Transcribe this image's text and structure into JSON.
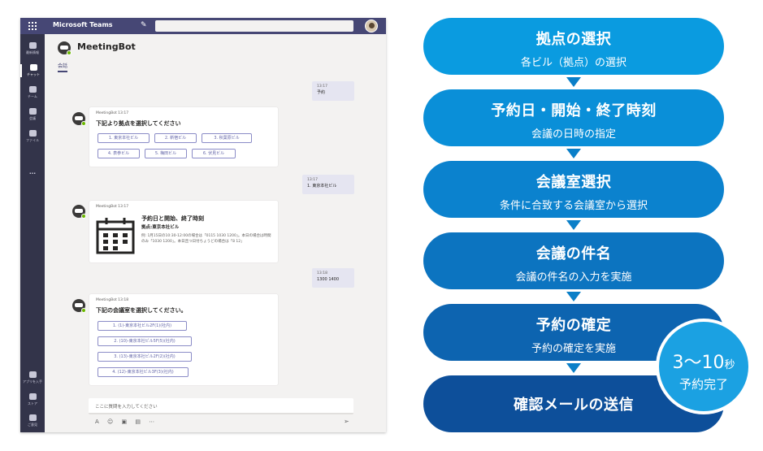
{
  "teams": {
    "app_name": "Microsoft Teams",
    "rail": [
      {
        "label": "最新情報"
      },
      {
        "label": "チャット"
      },
      {
        "label": "チーム"
      },
      {
        "label": "会議"
      },
      {
        "label": "ファイル"
      }
    ],
    "rail_more": "…",
    "rail_bottom": [
      {
        "label": "アプリを入手"
      },
      {
        "label": "ストア"
      },
      {
        "label": "ご意見"
      }
    ],
    "chat_title": "MeetingBot",
    "chat_tab": "会話",
    "messages": {
      "user1": {
        "time": "13:17",
        "text": "予約"
      },
      "bot1": {
        "meta": "MeetingBot  13:17",
        "heading": "下記より拠点を選択してください",
        "choices": [
          "1. 東京本社ビル",
          "2. 新宿ビル",
          "3. 秋葉原ビル",
          "4. 表参ビル",
          "5. 梅田ビル",
          "6. 伏見ビル"
        ]
      },
      "user2": {
        "time": "13:17",
        "text": "1. 東京本社ビル"
      },
      "bot2": {
        "meta": "MeetingBot  13:17",
        "heading": "予約日と開始、終了時刻",
        "subheading": "拠点:東京本社ビル",
        "body": "例: 1月15日の10:30-12:00の場合は「0115 1030 1200」。本日の場合は時間のみ「1030 1200」。本日且つ日付ちょうどの場合は「8 12」"
      },
      "user3": {
        "time": "13:18",
        "text": "1300 1400"
      },
      "bot3": {
        "meta": "MeetingBot  13:18",
        "heading": "下記の会議室を選択してください。",
        "choices": [
          "1. (1)-東京本社ビル2F(1)(社内)",
          "2. (10)-東京本社ビル5F(5)(社内)",
          "3. (13)-東京本社ビル2F(2)(社内)",
          "4. (12)-東京本社ビル3F(3)(社内)"
        ]
      }
    },
    "compose_placeholder": "ここに質問を入力してください",
    "compose_tools": "A ☺ ▣ ▤ ⋯",
    "send": "➢"
  },
  "steps": [
    {
      "title": "拠点の選択",
      "sub": "各ビル（拠点）の選択",
      "color": "#0a9be0"
    },
    {
      "title": "予約日・開始・終了時刻",
      "sub": "会議の日時の指定",
      "color": "#0a8fd8"
    },
    {
      "title": "会議室選択",
      "sub": "条件に合致する会議室から選択",
      "color": "#0b82ce"
    },
    {
      "title": "会議の件名",
      "sub": "会議の件名の入力を実施",
      "color": "#0c74c0"
    },
    {
      "title": "予約の確定",
      "sub": "予約の確定を実施",
      "color": "#0d64b0"
    },
    {
      "title": "確認メールの送信",
      "sub": "",
      "color": "#0d4f9a"
    }
  ],
  "badge": {
    "time": "3～10",
    "unit": "秒",
    "label": "予約完了"
  }
}
